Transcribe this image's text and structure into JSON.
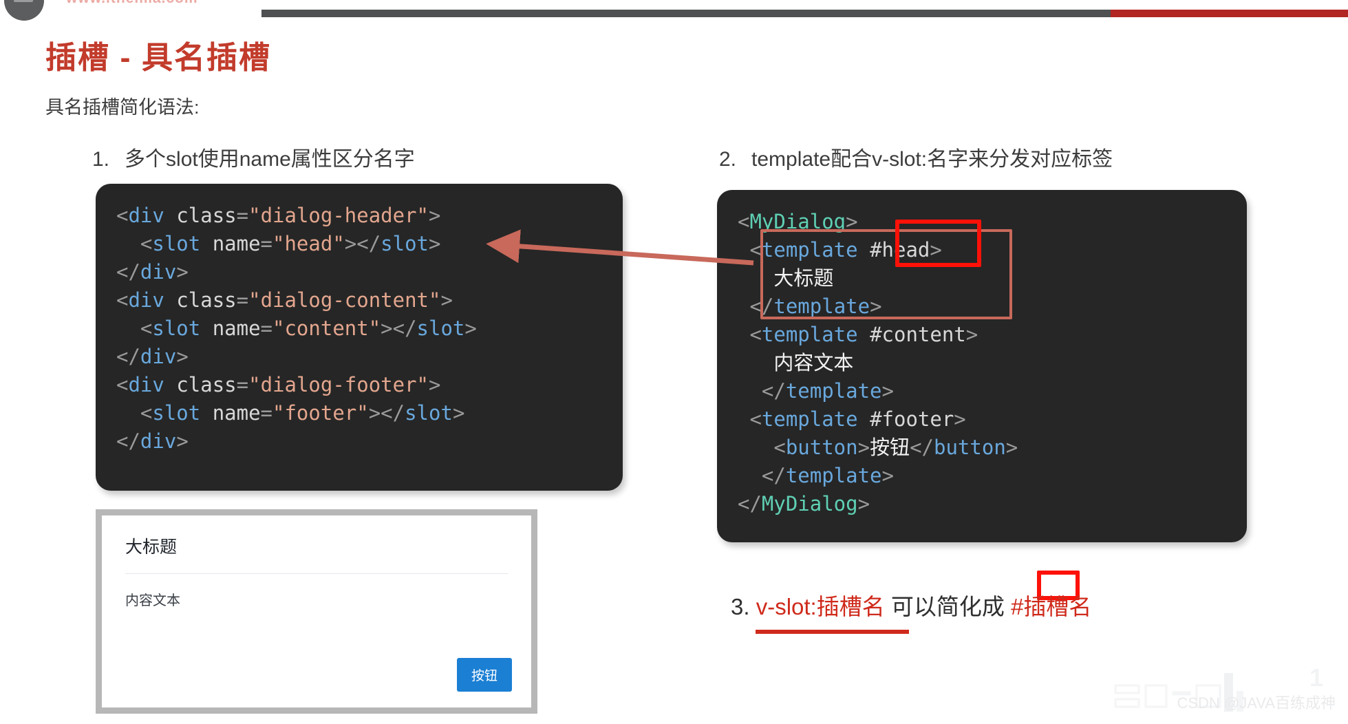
{
  "header": {
    "site_url": "www.itheima.com",
    "logo_icon": "circle-logo-icon"
  },
  "title": "插槽 - 具名插槽",
  "subtitle": "具名插槽简化语法:",
  "points": [
    {
      "index": "1.",
      "text": "多个slot使用name属性区分名字"
    },
    {
      "index": "2.",
      "text": "template配合v-slot:名字来分发对应标签"
    }
  ],
  "item3": {
    "index": "3.",
    "part1": "v-slot:插槽名",
    "part2": " 可以简化成 ",
    "part3": "#插槽名"
  },
  "code_left": {
    "lines": [
      [
        {
          "t": "punc",
          "s": "<"
        },
        {
          "t": "tag",
          "s": "div"
        },
        {
          "t": "punc",
          "s": " "
        },
        {
          "t": "attr",
          "s": "class"
        },
        {
          "t": "punc",
          "s": "="
        },
        {
          "t": "val",
          "s": "\"dialog-header\""
        },
        {
          "t": "punc",
          "s": ">"
        }
      ],
      [
        {
          "t": "punc",
          "s": "  <"
        },
        {
          "t": "tag",
          "s": "slot"
        },
        {
          "t": "punc",
          "s": " "
        },
        {
          "t": "attr",
          "s": "name"
        },
        {
          "t": "punc",
          "s": "="
        },
        {
          "t": "val",
          "s": "\"head\""
        },
        {
          "t": "punc",
          "s": "></"
        },
        {
          "t": "tag",
          "s": "slot"
        },
        {
          "t": "punc",
          "s": ">"
        }
      ],
      [
        {
          "t": "punc",
          "s": "</"
        },
        {
          "t": "tag",
          "s": "div"
        },
        {
          "t": "punc",
          "s": ">"
        }
      ],
      [
        {
          "t": "punc",
          "s": "<"
        },
        {
          "t": "tag",
          "s": "div"
        },
        {
          "t": "punc",
          "s": " "
        },
        {
          "t": "attr",
          "s": "class"
        },
        {
          "t": "punc",
          "s": "="
        },
        {
          "t": "val",
          "s": "\"dialog-content\""
        },
        {
          "t": "punc",
          "s": ">"
        }
      ],
      [
        {
          "t": "punc",
          "s": "  <"
        },
        {
          "t": "tag",
          "s": "slot"
        },
        {
          "t": "punc",
          "s": " "
        },
        {
          "t": "attr",
          "s": "name"
        },
        {
          "t": "punc",
          "s": "="
        },
        {
          "t": "val",
          "s": "\"content\""
        },
        {
          "t": "punc",
          "s": "></"
        },
        {
          "t": "tag",
          "s": "slot"
        },
        {
          "t": "punc",
          "s": ">"
        }
      ],
      [
        {
          "t": "punc",
          "s": "</"
        },
        {
          "t": "tag",
          "s": "div"
        },
        {
          "t": "punc",
          "s": ">"
        }
      ],
      [
        {
          "t": "punc",
          "s": "<"
        },
        {
          "t": "tag",
          "s": "div"
        },
        {
          "t": "punc",
          "s": " "
        },
        {
          "t": "attr",
          "s": "class"
        },
        {
          "t": "punc",
          "s": "="
        },
        {
          "t": "val",
          "s": "\"dialog-footer\""
        },
        {
          "t": "punc",
          "s": ">"
        }
      ],
      [
        {
          "t": "punc",
          "s": "  <"
        },
        {
          "t": "tag",
          "s": "slot"
        },
        {
          "t": "punc",
          "s": " "
        },
        {
          "t": "attr",
          "s": "name"
        },
        {
          "t": "punc",
          "s": "="
        },
        {
          "t": "val",
          "s": "\"footer\""
        },
        {
          "t": "punc",
          "s": "></"
        },
        {
          "t": "tag",
          "s": "slot"
        },
        {
          "t": "punc",
          "s": ">"
        }
      ],
      [
        {
          "t": "punc",
          "s": "</"
        },
        {
          "t": "tag",
          "s": "div"
        },
        {
          "t": "punc",
          "s": ">"
        }
      ]
    ]
  },
  "code_right": {
    "lines": [
      [
        {
          "t": "punc",
          "s": "<"
        },
        {
          "t": "comp",
          "s": "MyDialog"
        },
        {
          "t": "punc",
          "s": ">"
        }
      ],
      [
        {
          "t": "punc",
          "s": " <"
        },
        {
          "t": "tag",
          "s": "template"
        },
        {
          "t": "punc",
          "s": " "
        },
        {
          "t": "attr",
          "s": "#head"
        },
        {
          "t": "punc",
          "s": ">"
        }
      ],
      [
        {
          "t": "txt",
          "s": "   大标题"
        }
      ],
      [
        {
          "t": "punc",
          "s": " </"
        },
        {
          "t": "tag",
          "s": "template"
        },
        {
          "t": "punc",
          "s": ">"
        }
      ],
      [
        {
          "t": "punc",
          "s": " <"
        },
        {
          "t": "tag",
          "s": "template"
        },
        {
          "t": "punc",
          "s": " "
        },
        {
          "t": "attr",
          "s": "#content"
        },
        {
          "t": "punc",
          "s": ">"
        }
      ],
      [
        {
          "t": "txt",
          "s": "   内容文本"
        }
      ],
      [
        {
          "t": "punc",
          "s": "  </"
        },
        {
          "t": "tag",
          "s": "template"
        },
        {
          "t": "punc",
          "s": ">"
        }
      ],
      [
        {
          "t": "punc",
          "s": " <"
        },
        {
          "t": "tag",
          "s": "template"
        },
        {
          "t": "punc",
          "s": " "
        },
        {
          "t": "attr",
          "s": "#footer"
        },
        {
          "t": "punc",
          "s": ">"
        }
      ],
      [
        {
          "t": "punc",
          "s": "   <"
        },
        {
          "t": "tag",
          "s": "button"
        },
        {
          "t": "punc",
          "s": ">"
        },
        {
          "t": "txt",
          "s": "按钮"
        },
        {
          "t": "punc",
          "s": "</"
        },
        {
          "t": "tag",
          "s": "button"
        },
        {
          "t": "punc",
          "s": ">"
        }
      ],
      [
        {
          "t": "punc",
          "s": "  </"
        },
        {
          "t": "tag",
          "s": "template"
        },
        {
          "t": "punc",
          "s": ">"
        }
      ],
      [
        {
          "t": "punc",
          "s": "</"
        },
        {
          "t": "comp",
          "s": "MyDialog"
        },
        {
          "t": "punc",
          "s": ">"
        }
      ]
    ]
  },
  "dialog_preview": {
    "title": "大标题",
    "content": "内容文本",
    "button_label": "按钮",
    "button_color": "#1b7fd4"
  },
  "annotations": {
    "arrow_color": "#c8695b",
    "bright_rect_color": "#fd1108",
    "soft_rect_color": "#c8695b",
    "highlight_color": "#cf2a1b"
  },
  "watermark": {
    "text": "CSDN @JAVA百练成神",
    "page": "1"
  }
}
